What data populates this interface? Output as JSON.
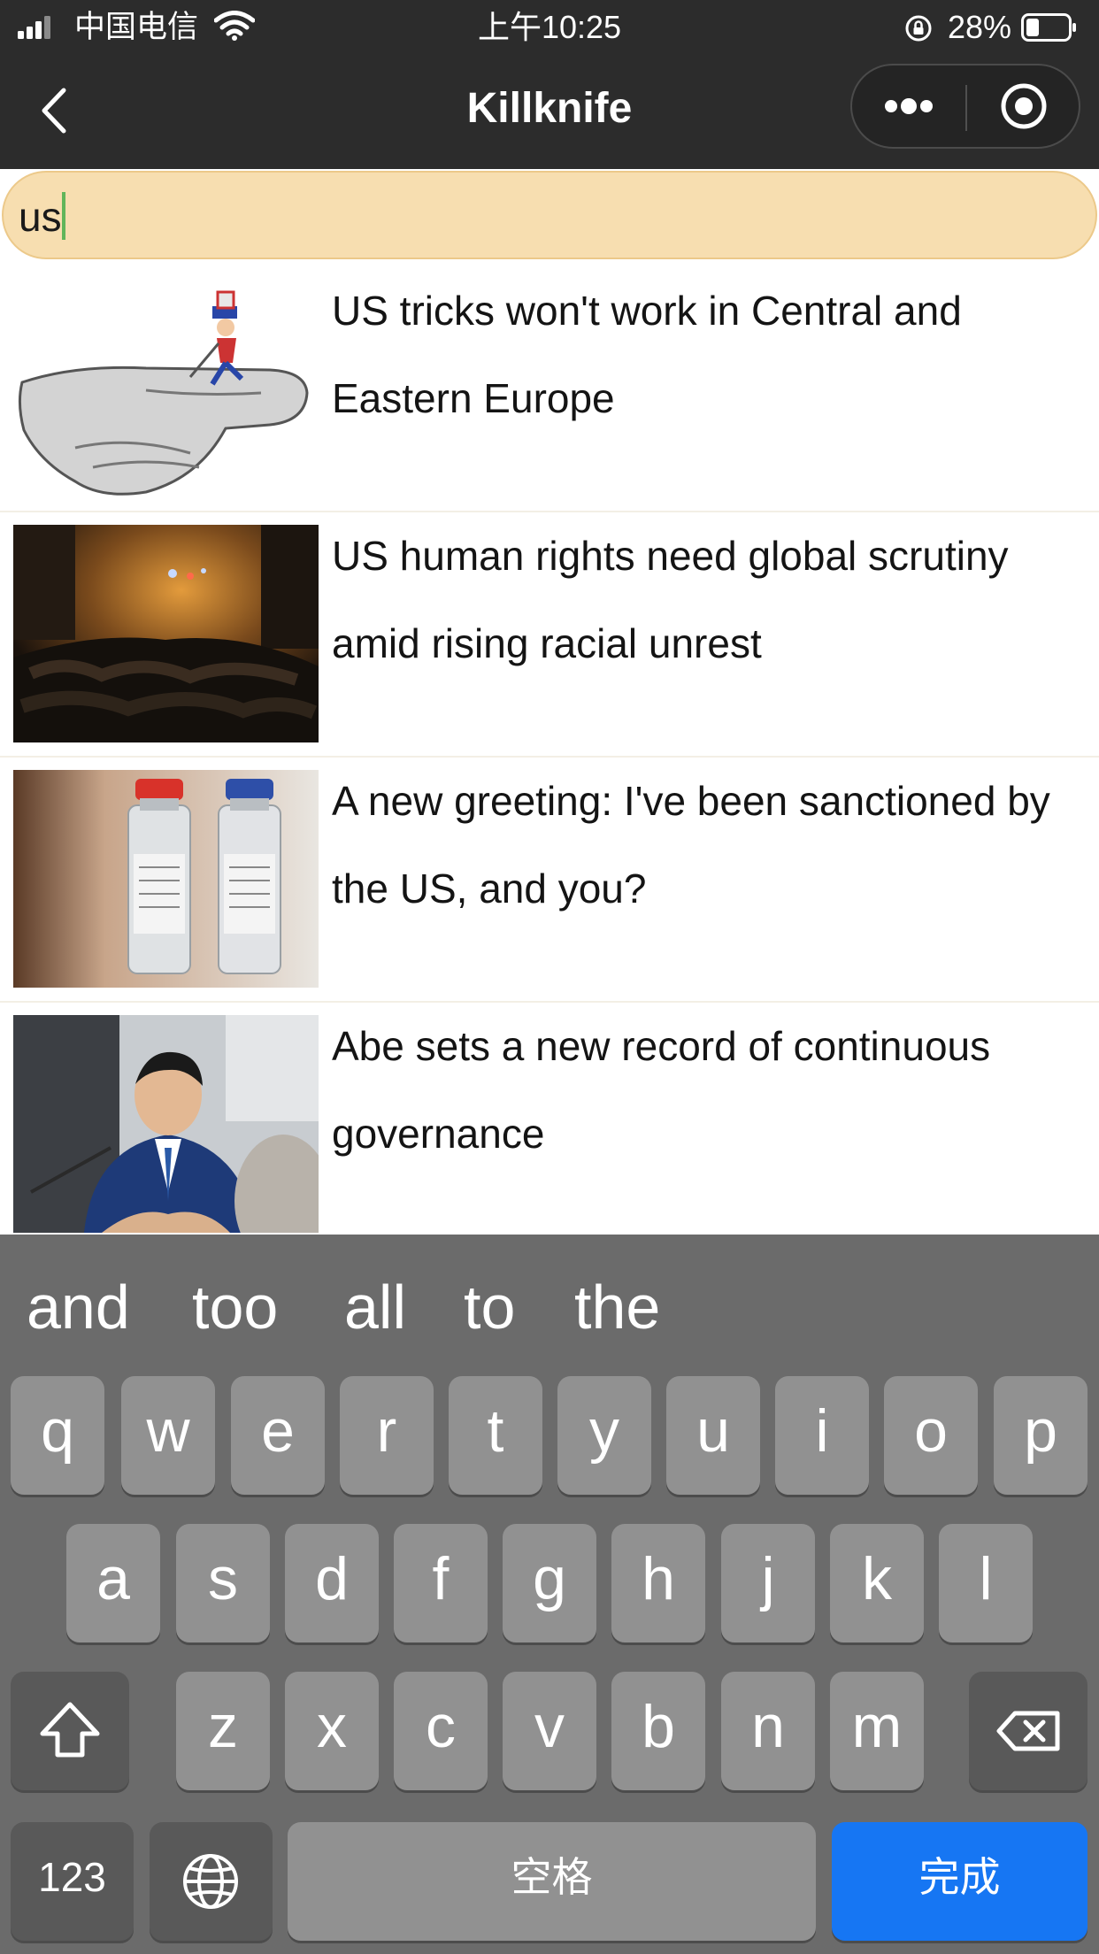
{
  "status_bar": {
    "carrier": "中国电信",
    "time": "上午10:25",
    "battery": "28%"
  },
  "nav": {
    "title": "Killknife",
    "icons": [
      "back-arrow-icon",
      "more-dots-icon",
      "close-target-icon"
    ]
  },
  "search": {
    "value": "us"
  },
  "articles": [
    {
      "title": "US tricks won't work in Central and Eastern Europe"
    },
    {
      "title": "US human rights need global scrutiny amid rising racial unrest"
    },
    {
      "title": "A new greeting: I've been sanctioned by the US, and you?"
    },
    {
      "title": "Abe sets a new record of continuous governance"
    }
  ],
  "keyboard": {
    "suggestions": [
      "and",
      "too",
      "all",
      "to",
      "the"
    ],
    "row1": [
      "q",
      "w",
      "e",
      "r",
      "t",
      "y",
      "u",
      "i",
      "o",
      "p"
    ],
    "row2": [
      "a",
      "s",
      "d",
      "f",
      "g",
      "h",
      "j",
      "k",
      "l"
    ],
    "row3": [
      "z",
      "x",
      "c",
      "v",
      "b",
      "n",
      "m"
    ],
    "numbers_key": "123",
    "space_key": "空格",
    "done_key": "完成",
    "done_color": "#1676f3"
  }
}
